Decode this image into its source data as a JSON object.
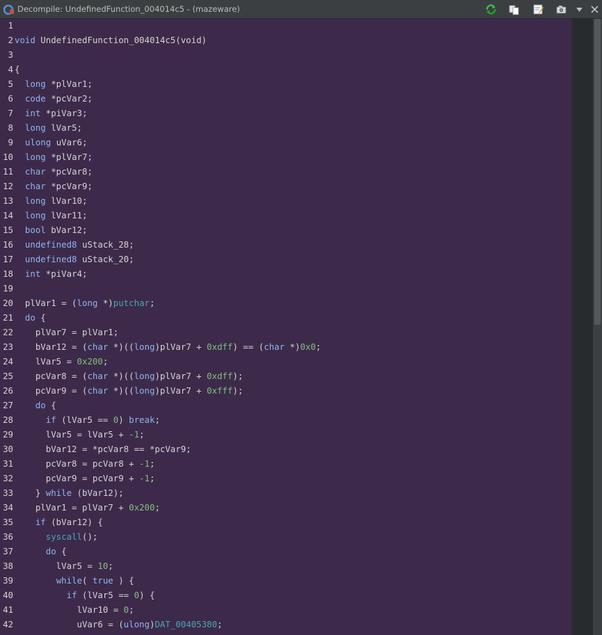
{
  "window": {
    "title": "Decompile: UndefinedFunction_004014c5 -  (mazeware)"
  },
  "toolbar": {
    "icons": [
      "refresh-icon",
      "copy-icon",
      "edit-icon",
      "snapshot-icon",
      "menu-arrow-icon"
    ]
  },
  "colors": {
    "editor_background": "#3d2a4a",
    "keyword": "#8fb4f0",
    "function": "#4aa5b7",
    "number": "#7fbf7f",
    "text": "#d4d4d4"
  },
  "code": {
    "lines": [
      {
        "no": "1",
        "tokens": []
      },
      {
        "no": "2",
        "tokens": [
          [
            "k",
            "void"
          ],
          [
            "t",
            " UndefinedFunction_004014c5(void)"
          ]
        ]
      },
      {
        "no": "3",
        "tokens": []
      },
      {
        "no": "4",
        "tokens": [
          [
            "t",
            "{"
          ]
        ]
      },
      {
        "no": "5",
        "tokens": [
          [
            "t",
            "  "
          ],
          [
            "k",
            "long"
          ],
          [
            "t",
            " *plVar1;"
          ]
        ]
      },
      {
        "no": "6",
        "tokens": [
          [
            "t",
            "  "
          ],
          [
            "k",
            "code"
          ],
          [
            "t",
            " *pcVar2;"
          ]
        ]
      },
      {
        "no": "7",
        "tokens": [
          [
            "t",
            "  "
          ],
          [
            "k",
            "int"
          ],
          [
            "t",
            " *piVar3;"
          ]
        ]
      },
      {
        "no": "8",
        "tokens": [
          [
            "t",
            "  "
          ],
          [
            "k",
            "long"
          ],
          [
            "t",
            " lVar5;"
          ]
        ]
      },
      {
        "no": "9",
        "tokens": [
          [
            "t",
            "  "
          ],
          [
            "k",
            "ulong"
          ],
          [
            "t",
            " uVar6;"
          ]
        ]
      },
      {
        "no": "10",
        "tokens": [
          [
            "t",
            "  "
          ],
          [
            "k",
            "long"
          ],
          [
            "t",
            " *plVar7;"
          ]
        ]
      },
      {
        "no": "11",
        "tokens": [
          [
            "t",
            "  "
          ],
          [
            "k",
            "char"
          ],
          [
            "t",
            " *pcVar8;"
          ]
        ]
      },
      {
        "no": "12",
        "tokens": [
          [
            "t",
            "  "
          ],
          [
            "k",
            "char"
          ],
          [
            "t",
            " *pcVar9;"
          ]
        ]
      },
      {
        "no": "13",
        "tokens": [
          [
            "t",
            "  "
          ],
          [
            "k",
            "long"
          ],
          [
            "t",
            " lVar10;"
          ]
        ]
      },
      {
        "no": "14",
        "tokens": [
          [
            "t",
            "  "
          ],
          [
            "k",
            "long"
          ],
          [
            "t",
            " lVar11;"
          ]
        ]
      },
      {
        "no": "15",
        "tokens": [
          [
            "t",
            "  "
          ],
          [
            "k",
            "bool"
          ],
          [
            "t",
            " bVar12;"
          ]
        ]
      },
      {
        "no": "16",
        "tokens": [
          [
            "t",
            "  "
          ],
          [
            "k",
            "undefined8"
          ],
          [
            "t",
            " uStack_28;"
          ]
        ]
      },
      {
        "no": "17",
        "tokens": [
          [
            "t",
            "  "
          ],
          [
            "k",
            "undefined8"
          ],
          [
            "t",
            " uStack_20;"
          ]
        ]
      },
      {
        "no": "18",
        "tokens": [
          [
            "t",
            "  "
          ],
          [
            "k",
            "int"
          ],
          [
            "t",
            " *piVar4;"
          ]
        ]
      },
      {
        "no": "19",
        "tokens": []
      },
      {
        "no": "20",
        "tokens": [
          [
            "t",
            "  plVar1 = ("
          ],
          [
            "k",
            "long"
          ],
          [
            "t",
            " *)"
          ],
          [
            "f",
            "putchar"
          ],
          [
            "t",
            ";"
          ]
        ]
      },
      {
        "no": "21",
        "tokens": [
          [
            "t",
            "  "
          ],
          [
            "k",
            "do"
          ],
          [
            "t",
            " {"
          ]
        ]
      },
      {
        "no": "22",
        "tokens": [
          [
            "t",
            "    plVar7 = plVar1;"
          ]
        ]
      },
      {
        "no": "23",
        "tokens": [
          [
            "t",
            "    bVar12 = ("
          ],
          [
            "k",
            "char"
          ],
          [
            "t",
            " *)(("
          ],
          [
            "k",
            "long"
          ],
          [
            "t",
            ")plVar7 + "
          ],
          [
            "n",
            "0xdff"
          ],
          [
            "t",
            ") == ("
          ],
          [
            "k",
            "char"
          ],
          [
            "t",
            " *)"
          ],
          [
            "n",
            "0x0"
          ],
          [
            "t",
            ";"
          ]
        ]
      },
      {
        "no": "24",
        "tokens": [
          [
            "t",
            "    lVar5 = "
          ],
          [
            "n",
            "0x200"
          ],
          [
            "t",
            ";"
          ]
        ]
      },
      {
        "no": "25",
        "tokens": [
          [
            "t",
            "    pcVar8 = ("
          ],
          [
            "k",
            "char"
          ],
          [
            "t",
            " *)(("
          ],
          [
            "k",
            "long"
          ],
          [
            "t",
            ")plVar7 + "
          ],
          [
            "n",
            "0xdff"
          ],
          [
            "t",
            ");"
          ]
        ]
      },
      {
        "no": "26",
        "tokens": [
          [
            "t",
            "    pcVar9 = ("
          ],
          [
            "k",
            "char"
          ],
          [
            "t",
            " *)(("
          ],
          [
            "k",
            "long"
          ],
          [
            "t",
            ")plVar7 + "
          ],
          [
            "n",
            "0xfff"
          ],
          [
            "t",
            ");"
          ]
        ]
      },
      {
        "no": "27",
        "tokens": [
          [
            "t",
            "    "
          ],
          [
            "k",
            "do"
          ],
          [
            "t",
            " {"
          ]
        ]
      },
      {
        "no": "28",
        "tokens": [
          [
            "t",
            "      "
          ],
          [
            "k",
            "if"
          ],
          [
            "t",
            " (lVar5 == "
          ],
          [
            "n",
            "0"
          ],
          [
            "t",
            ") "
          ],
          [
            "k",
            "break"
          ],
          [
            "t",
            ";"
          ]
        ]
      },
      {
        "no": "29",
        "tokens": [
          [
            "t",
            "      lVar5 = lVar5 + "
          ],
          [
            "n",
            "-1"
          ],
          [
            "t",
            ";"
          ]
        ]
      },
      {
        "no": "30",
        "tokens": [
          [
            "t",
            "      bVar12 = *pcVar8 == *pcVar9;"
          ]
        ]
      },
      {
        "no": "31",
        "tokens": [
          [
            "t",
            "      pcVar8 = pcVar8 + "
          ],
          [
            "n",
            "-1"
          ],
          [
            "t",
            ";"
          ]
        ]
      },
      {
        "no": "32",
        "tokens": [
          [
            "t",
            "      pcVar9 = pcVar9 + "
          ],
          [
            "n",
            "-1"
          ],
          [
            "t",
            ";"
          ]
        ]
      },
      {
        "no": "33",
        "tokens": [
          [
            "t",
            "    } "
          ],
          [
            "k",
            "while"
          ],
          [
            "t",
            " (bVar12);"
          ]
        ]
      },
      {
        "no": "34",
        "tokens": [
          [
            "t",
            "    plVar1 = plVar7 + "
          ],
          [
            "n",
            "0x200"
          ],
          [
            "t",
            ";"
          ]
        ]
      },
      {
        "no": "35",
        "tokens": [
          [
            "t",
            "    "
          ],
          [
            "k",
            "if"
          ],
          [
            "t",
            " (bVar12) {"
          ]
        ]
      },
      {
        "no": "36",
        "tokens": [
          [
            "t",
            "      "
          ],
          [
            "f",
            "syscall"
          ],
          [
            "t",
            "();"
          ]
        ]
      },
      {
        "no": "37",
        "tokens": [
          [
            "t",
            "      "
          ],
          [
            "k",
            "do"
          ],
          [
            "t",
            " {"
          ]
        ]
      },
      {
        "no": "38",
        "tokens": [
          [
            "t",
            "        lVar5 = "
          ],
          [
            "n",
            "10"
          ],
          [
            "t",
            ";"
          ]
        ]
      },
      {
        "no": "39",
        "tokens": [
          [
            "t",
            "        "
          ],
          [
            "k",
            "while"
          ],
          [
            "t",
            "( "
          ],
          [
            "k",
            "true"
          ],
          [
            "t",
            " ) {"
          ]
        ]
      },
      {
        "no": "40",
        "tokens": [
          [
            "t",
            "          "
          ],
          [
            "k",
            "if"
          ],
          [
            "t",
            " (lVar5 == "
          ],
          [
            "n",
            "0"
          ],
          [
            "t",
            ") {"
          ]
        ]
      },
      {
        "no": "41",
        "tokens": [
          [
            "t",
            "            lVar10 = "
          ],
          [
            "n",
            "0"
          ],
          [
            "t",
            ";"
          ]
        ]
      },
      {
        "no": "42",
        "tokens": [
          [
            "t",
            "            uVar6 = ("
          ],
          [
            "k",
            "ulong"
          ],
          [
            "t",
            ")"
          ],
          [
            "f",
            "DAT_00405380"
          ],
          [
            "t",
            ";"
          ]
        ]
      }
    ]
  }
}
